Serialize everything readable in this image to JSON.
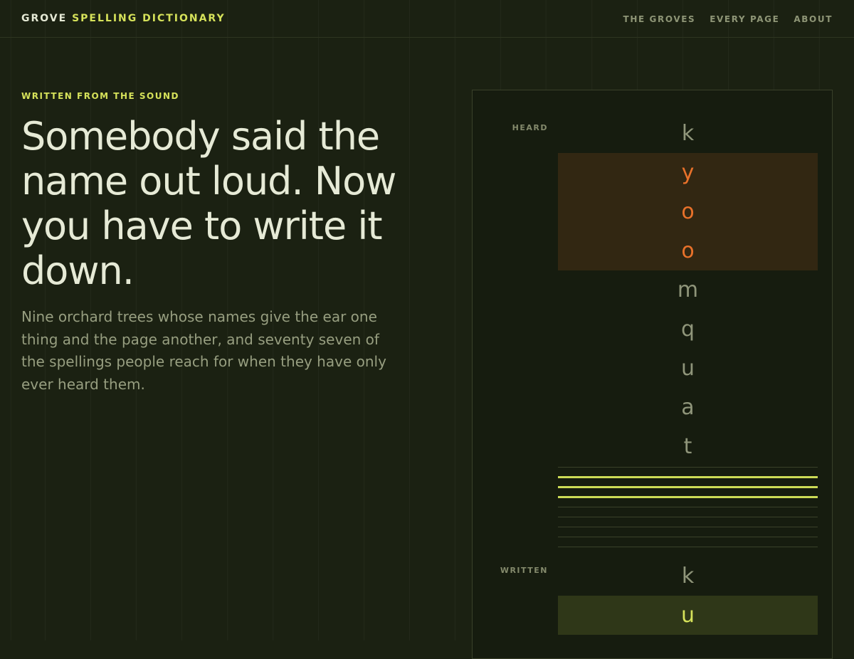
{
  "header": {
    "brand_first": "GROVE",
    "brand_second": "SPELLING DICTIONARY",
    "nav": [
      "THE GROVES",
      "EVERY PAGE",
      "ABOUT"
    ]
  },
  "hero": {
    "eyebrow": "WRITTEN FROM THE SOUND",
    "title": "Somebody said the name out loud. Now you have to write it down.",
    "lede": "Nine orchard trees whose names give the ear one thing and the page another, and seventy seven of the spellings people reach for when they have only ever heard them."
  },
  "panel": {
    "heard_label": "HEARD",
    "heard_letters": [
      "k",
      "y",
      "o",
      "o",
      "m",
      "q",
      "u",
      "a",
      "t"
    ],
    "heard_highlight_indices": [
      1,
      2,
      3
    ],
    "written_label": "WRITTEN",
    "written_letters": [
      "k",
      "u"
    ],
    "written_highlight_indices": [
      1
    ]
  },
  "colors": {
    "background": "#1b2112",
    "accent": "#d6e25a",
    "heard_highlight": "#e8712a",
    "text": "#e6ead6",
    "muted": "#979e80"
  }
}
